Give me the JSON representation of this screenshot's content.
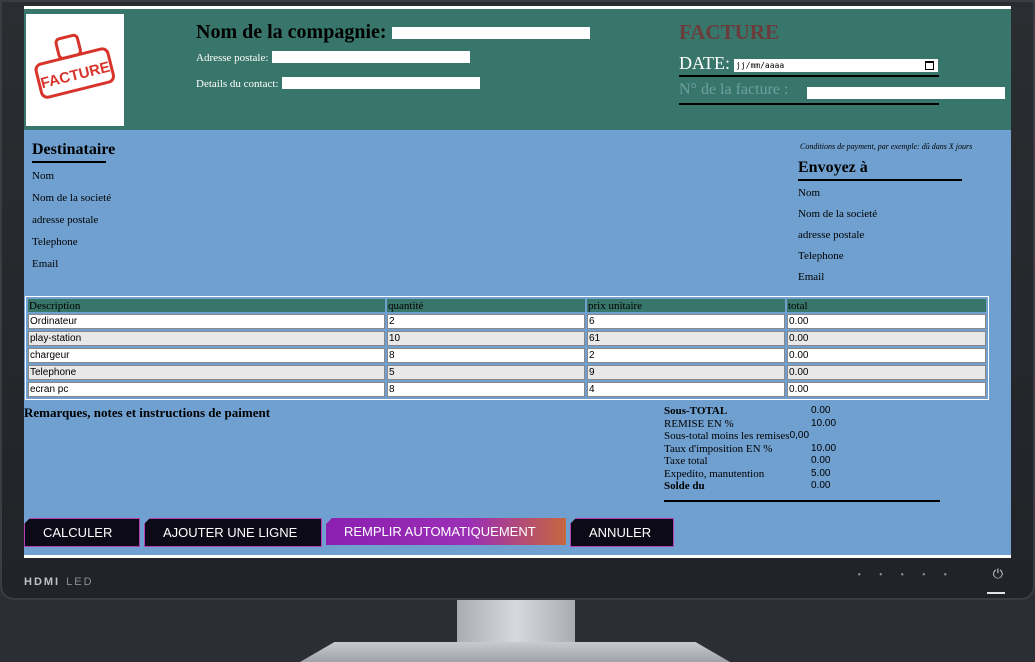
{
  "header": {
    "company_label": "Nom de la compagnie:",
    "address_label": "Adresse postale:",
    "contact_label": "Details du contact:",
    "invoice_title": "FACTURE",
    "date_label": "DATE:",
    "date_placeholder": "jj/mm/aaaa",
    "invoice_num_label": "N° de la facture :",
    "logo_text": "FACTURE"
  },
  "destinataire": {
    "title": "Destinataire",
    "lines": [
      "Nom",
      "Nom de la societé",
      "adresse postale",
      "Telephone",
      "Email"
    ]
  },
  "conditions": "Conditions de payment, par exemple: dû dans X jours",
  "envoyez": {
    "title": "Envoyez à",
    "lines": [
      "Nom",
      "Nom de la societé",
      "adresse postale",
      "Telephone",
      "Email"
    ]
  },
  "table": {
    "headers": [
      "Description",
      "quantité",
      "prix unitaire",
      "total"
    ],
    "rows": [
      [
        "Ordinateur",
        "2",
        "6",
        "0.00"
      ],
      [
        "play-station",
        "10",
        "61",
        "0.00"
      ],
      [
        "chargeur",
        "8",
        "2",
        "0.00"
      ],
      [
        "Telephone",
        "5",
        "9",
        "0.00"
      ],
      [
        "ecran pc",
        "8",
        "4",
        "0.00"
      ]
    ]
  },
  "remarks": "Remarques, notes et instructions de paiment",
  "totals": [
    {
      "label": "Sous-TOTAL",
      "value": "0.00"
    },
    {
      "label": "REMISE EN %",
      "value": "10.00"
    },
    {
      "label": "Sous-total moins les remises",
      "value": "0,00"
    },
    {
      "label": "Taux d'imposition EN %",
      "value": "10.00"
    },
    {
      "label": "Taxe total",
      "value": "0.00"
    },
    {
      "label": "Expedito, manutention",
      "value": "5.00"
    },
    {
      "label": "Solde du",
      "value": "0.00"
    }
  ],
  "buttons": {
    "calc": "CALCULER",
    "add": "AJOUTER UNE LIGNE",
    "auto": "REMPLIR AUTOMATIQUEMENT",
    "cancel": "ANNULER"
  },
  "monitor": {
    "brand": "HDMI",
    "led": "LED",
    "power_icon": "power-icon"
  },
  "colors": {
    "header": "#38756a",
    "body": "#6fa0d0",
    "button_accent": "#8b1fb0"
  }
}
